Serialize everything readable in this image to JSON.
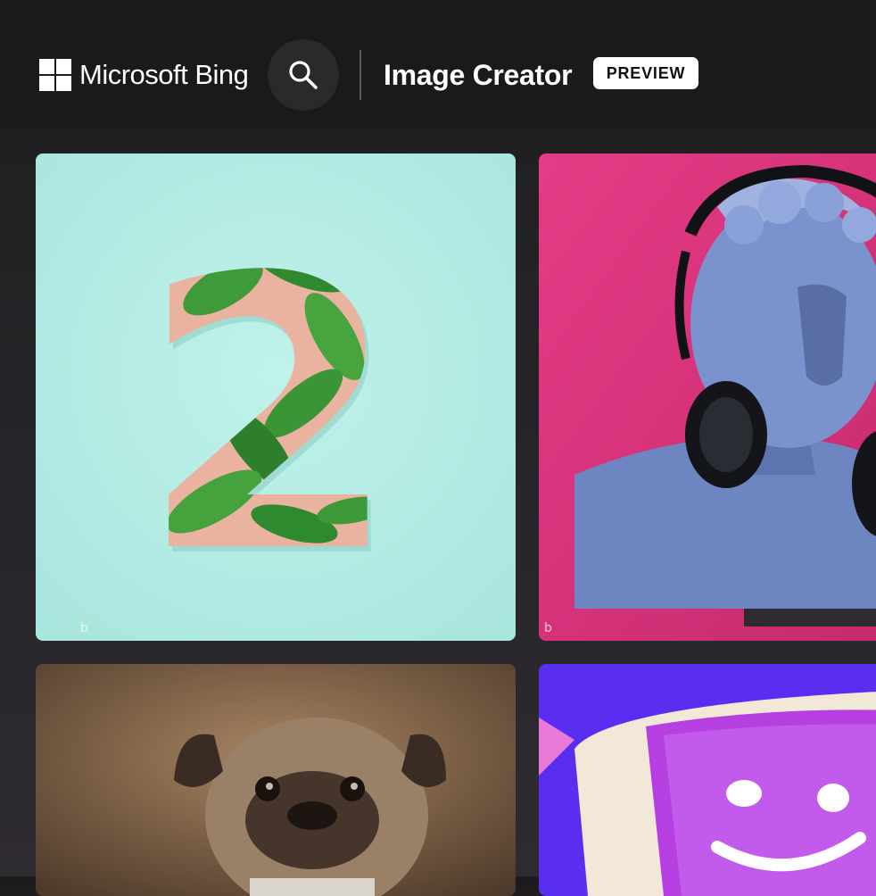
{
  "header": {
    "brand": "Microsoft Bing",
    "app_title": "Image Creator",
    "badge": "PREVIEW"
  },
  "icons": {
    "logo": "microsoft-logo-icon",
    "search": "search-icon",
    "watermark": "bing-watermark-icon"
  },
  "gallery": {
    "cards": [
      {
        "subject": "number-two-leaves",
        "overlay_text": "2"
      },
      {
        "subject": "statue-bust-headphones"
      },
      {
        "subject": "pug-portrait"
      },
      {
        "subject": "retro-computer-smiley"
      }
    ]
  },
  "colors": {
    "header_bg": "#1b1a1a",
    "page_bg": "#262428",
    "card1_bg": "#b3ebe4",
    "card2_bg": "#e2367f",
    "card4_bg": "#5a2ef0"
  }
}
